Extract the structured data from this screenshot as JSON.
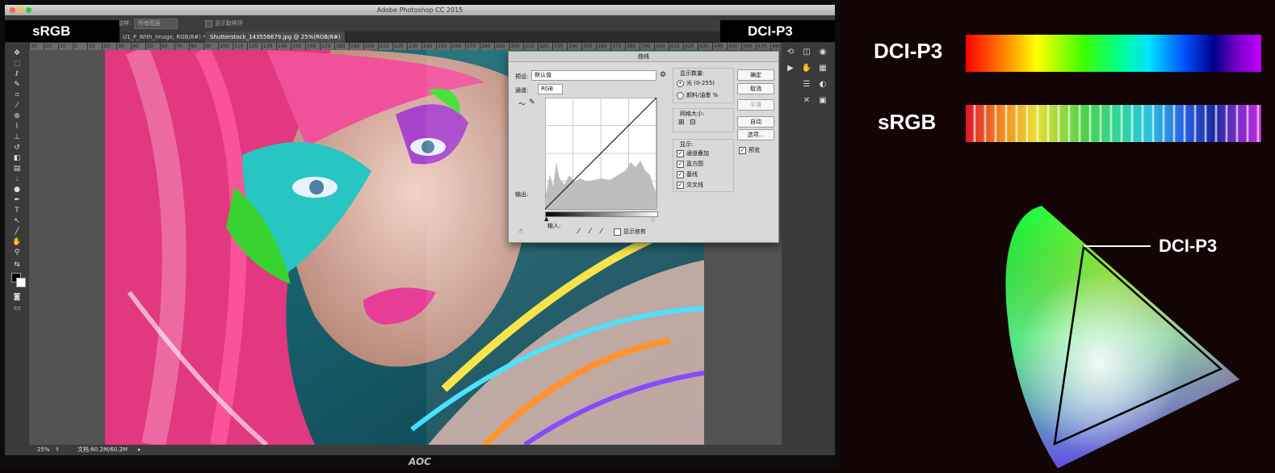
{
  "window": {
    "title": "Adobe Photoshop CC 2015"
  },
  "options_bar": {
    "mode_label": "取样:",
    "mode_value": "所有图层",
    "show_ring": "显示取样环"
  },
  "tabs": [
    {
      "label": "U1_F_With_Image, RGB/8#) *"
    },
    {
      "label": "Shutterstock_143556679.jpg @ 25%(RGB/8#)"
    }
  ],
  "ruler_ticks": [
    "30",
    "20",
    "10",
    "0",
    "10",
    "20",
    "30",
    "40",
    "50",
    "60",
    "70",
    "80",
    "90",
    "100",
    "110",
    "120",
    "130",
    "140",
    "150",
    "160",
    "170",
    "180",
    "190",
    "200",
    "210",
    "220",
    "230",
    "240",
    "250",
    "260",
    "270",
    "280",
    "290",
    "300",
    "310",
    "320",
    "330",
    "340",
    "350",
    "360",
    "370",
    "380",
    "390",
    "400",
    "410",
    "420",
    "430",
    "440",
    "450",
    "460",
    "470",
    "480"
  ],
  "overlay_labels": {
    "left": "sRGB",
    "right": "DCI-P3"
  },
  "curves_dialog": {
    "title": "曲线",
    "preset_label": "预设:",
    "preset_value": "默认值",
    "channel_label": "通道:",
    "channel_value": "RGB",
    "output_label": "输出:",
    "input_label": "输入:",
    "show_clipping": "显示修剪",
    "display_amount_title": "显示数量:",
    "light_option": "光 (0-255)",
    "pigment_option": "颜料/油墨 %",
    "grid_size_title": "网格大小:",
    "show_title": "显示:",
    "show_options": [
      "通道叠加",
      "直方图",
      "基线",
      "交叉线"
    ],
    "buttons": {
      "ok": "确定",
      "cancel": "取消",
      "smooth": "平滑",
      "auto": "自动",
      "options": "选项..."
    },
    "preview_label": "预览"
  },
  "status_bar": {
    "zoom": "25%",
    "doc": "文档:60.2M/60.2M"
  },
  "monitor_brand": "AOC",
  "right_panel": {
    "bar_labels": {
      "top": "DCI-P3",
      "bottom": "sRGB"
    },
    "gamut_label": "DCI-P3"
  }
}
